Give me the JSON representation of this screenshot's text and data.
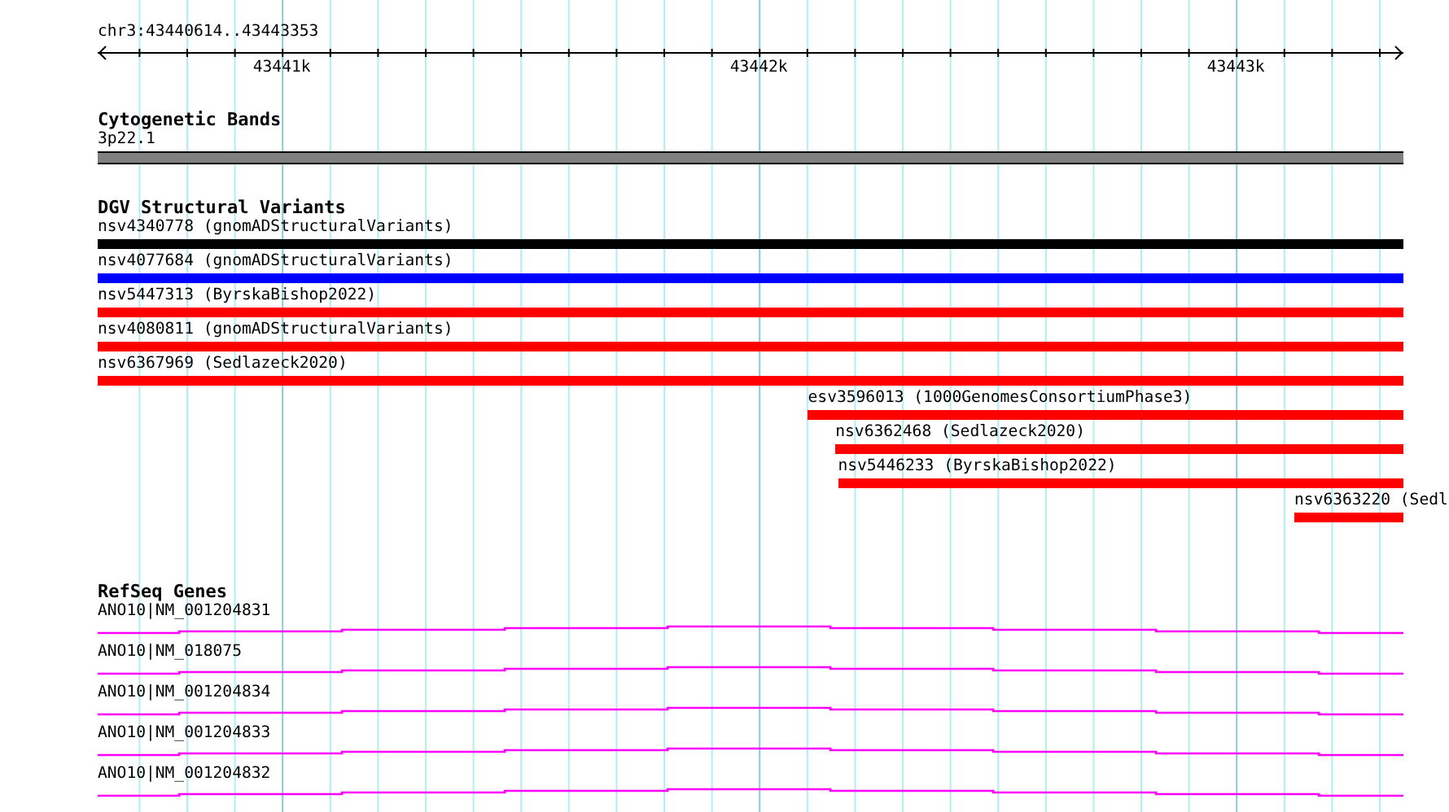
{
  "ruler": {
    "location": "chr3:43440614..43443353",
    "tick_labels": [
      "43441k",
      "43442k",
      "43443k"
    ]
  },
  "tracks": [
    {
      "kind": "cytoband",
      "title": "Cytogenetic Bands",
      "features": [
        {
          "label": "3p22.1"
        }
      ]
    },
    {
      "kind": "variants",
      "title": "DGV Structural Variants",
      "features": [
        {
          "label": "nsv4340778 (gnomADStructuralVariants)",
          "color": "#000000"
        },
        {
          "label": "nsv4077684 (gnomADStructuralVariants)",
          "color": "#0000ff"
        },
        {
          "label": "nsv5447313 (ByrskaBishop2022)",
          "color": "#ff0000"
        },
        {
          "label": "nsv4080811 (gnomADStructuralVariants)",
          "color": "#ff0000"
        },
        {
          "label": "nsv6367969 (Sedlazeck2020)",
          "color": "#ff0000"
        },
        {
          "label": "esv3596013 (1000GenomesConsortiumPhase3)",
          "color": "#ff0000"
        },
        {
          "label": "nsv6362468 (Sedlazeck2020)",
          "color": "#ff0000"
        },
        {
          "label": "nsv5446233 (ByrskaBishop2022)",
          "color": "#ff0000"
        },
        {
          "label": "nsv6363220 (Sedl",
          "color": "#ff0000"
        }
      ]
    },
    {
      "kind": "genes",
      "title": "RefSeq Genes",
      "features": [
        {
          "label": "ANO10|NM_001204831"
        },
        {
          "label": "ANO10|NM_018075"
        },
        {
          "label": "ANO10|NM_001204834"
        },
        {
          "label": "ANO10|NM_001204833"
        },
        {
          "label": "ANO10|NM_001204832"
        }
      ]
    }
  ]
}
